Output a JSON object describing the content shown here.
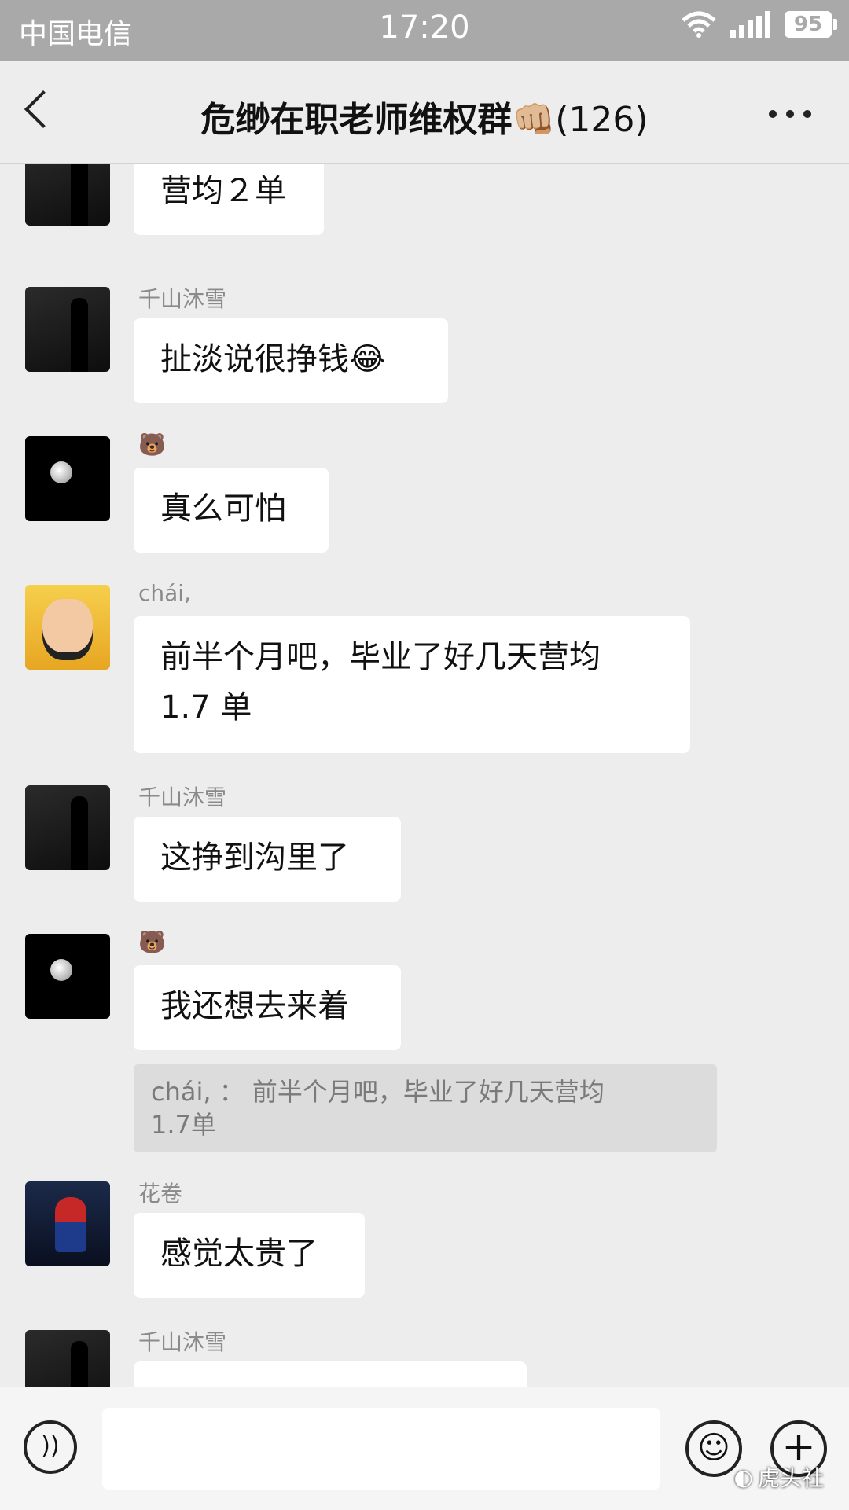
{
  "status_bar": {
    "carrier": "中国电信",
    "time": "17:20",
    "battery": "95",
    "wifi_icon": "wifi-icon",
    "signal_icon": "signal-icon"
  },
  "nav": {
    "back_icon": "chevron-left-icon",
    "title": "危缈在职老师维权群",
    "title_emoji": "👊🏼",
    "member_count": "(126)",
    "more_icon": "more-dots-icon"
  },
  "messages": [
    {
      "sender": "",
      "avatar": "silhouette",
      "text": "营均２单"
    },
    {
      "sender": "千山沐雪",
      "avatar": "silhouette",
      "text": "扯淡说很挣钱😂"
    },
    {
      "sender": "🐻",
      "avatar": "moon",
      "text": "真么可怕"
    },
    {
      "sender": "chái,",
      "avatar": "buddha",
      "text": "前半个月吧，毕业了好几天营均",
      "text2": "1.7 单"
    },
    {
      "sender": "千山沐雪",
      "avatar": "silhouette",
      "text": "这挣到沟里了"
    },
    {
      "sender": "🐻",
      "avatar": "moon",
      "text": "我还想去来着",
      "quote": "chái, ： 前半个月吧，毕业了好几天营均",
      "quote2": "1.7单"
    },
    {
      "sender": "花卷",
      "avatar": "spider",
      "text": "感觉太贵了"
    },
    {
      "sender": "千山沐雪",
      "avatar": "silhouette",
      "text": ""
    }
  ],
  "input_bar": {
    "voice_icon": "voice-icon",
    "emoji_icon": "emoji-icon",
    "plus_icon": "plus-icon",
    "watermark": "虎头社"
  }
}
